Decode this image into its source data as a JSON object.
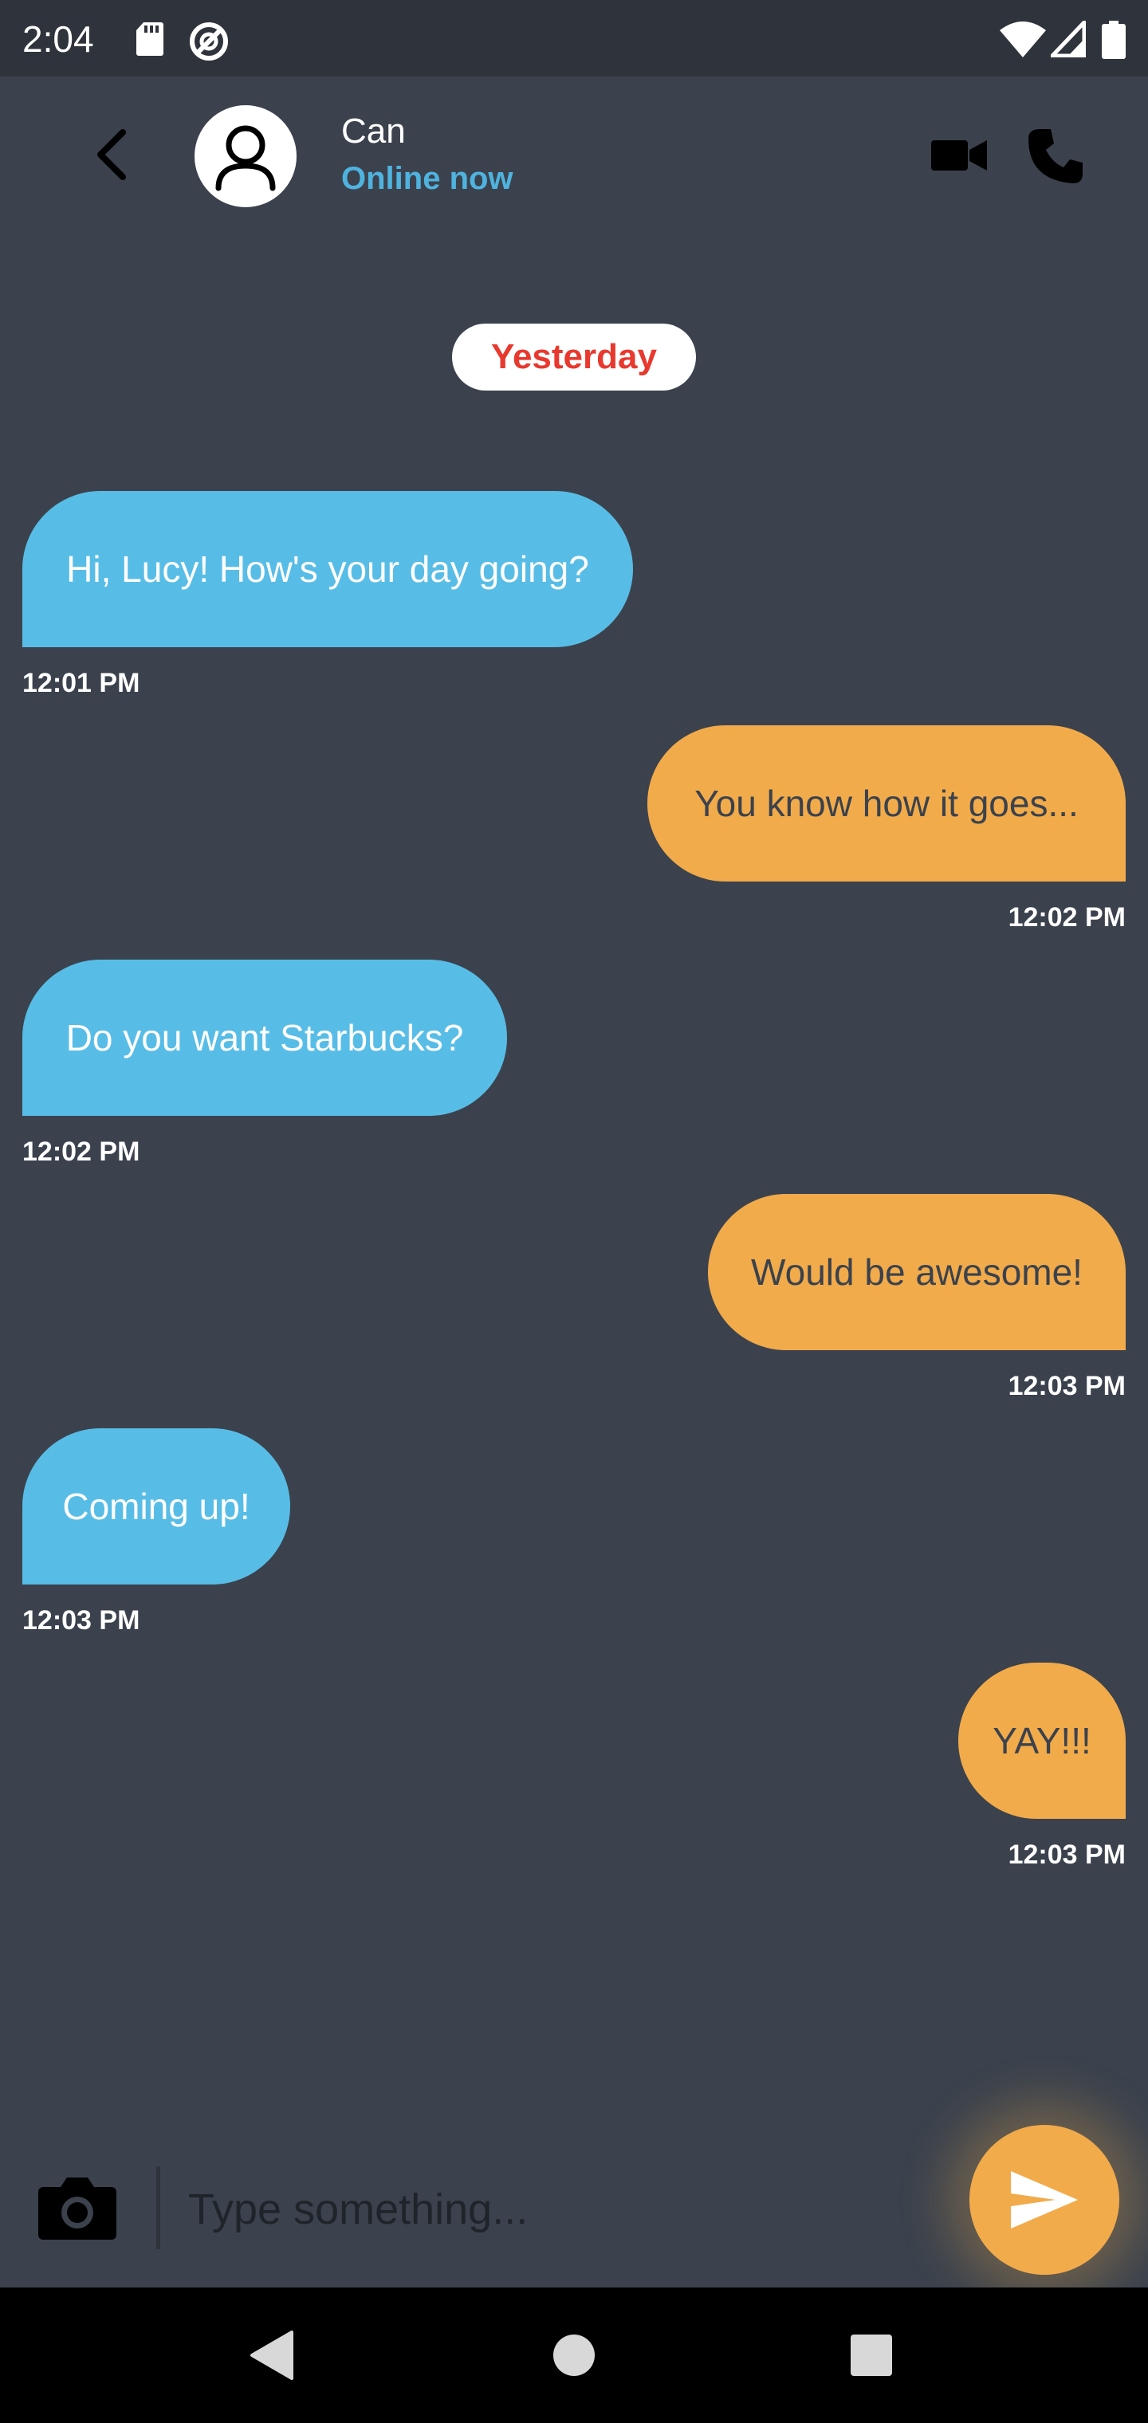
{
  "status_bar": {
    "time": "2:04",
    "icons": [
      "sd-card-icon",
      "do-not-disturb-icon",
      "wifi-icon",
      "signal-icon",
      "battery-icon"
    ]
  },
  "header": {
    "contact_name": "Can",
    "contact_status": "Online now",
    "status_color": "#4fb3df",
    "icons": [
      "back-arrow-icon",
      "avatar-person-icon",
      "video-camera-icon",
      "phone-icon"
    ]
  },
  "date_divider": "Yesterday",
  "messages": [
    {
      "direction": "incoming",
      "text": "Hi, Lucy! How's your day going?",
      "time": "12:01 PM"
    },
    {
      "direction": "outgoing",
      "text": "You know how it goes...",
      "time": "12:02 PM"
    },
    {
      "direction": "incoming",
      "text": "Do you want Starbucks?",
      "time": "12:02 PM"
    },
    {
      "direction": "outgoing",
      "text": "Would be awesome!",
      "time": "12:03 PM"
    },
    {
      "direction": "incoming",
      "text": "Coming up!",
      "time": "12:03 PM"
    },
    {
      "direction": "outgoing",
      "text": "YAY!!!",
      "time": "12:03 PM"
    }
  ],
  "composer": {
    "placeholder": "Type something...",
    "value": "",
    "icons": [
      "camera-icon",
      "send-icon"
    ]
  },
  "nav_bar": {
    "icons": [
      "nav-back-icon",
      "nav-home-icon",
      "nav-recents-icon"
    ]
  },
  "colors": {
    "background": "#3b424d",
    "incoming_bubble": "#58bde6",
    "outgoing_bubble": "#f2ab4a",
    "date_text": "#e8392f"
  }
}
